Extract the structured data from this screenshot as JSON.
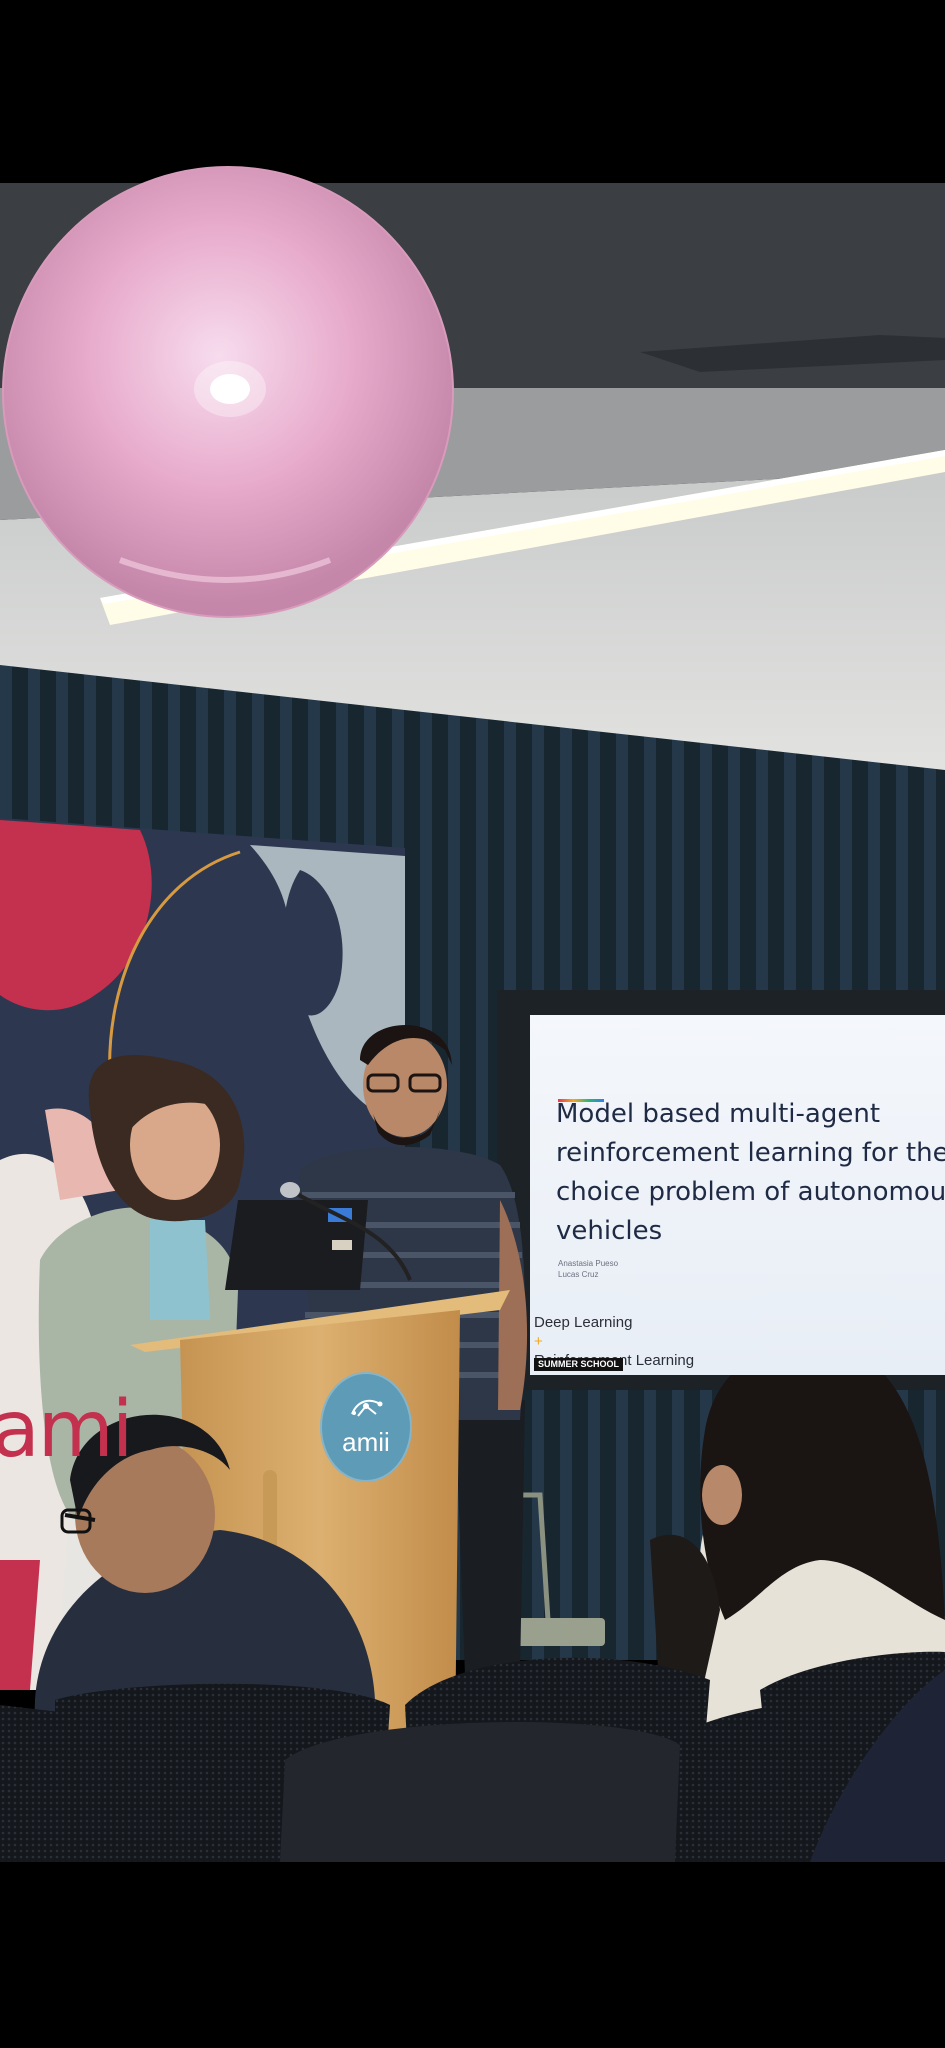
{
  "slide": {
    "title_lines": [
      "Model based multi-agent",
      "reinforcement learning for the r",
      "choice problem of autonomous",
      "vehicles"
    ],
    "authors": [
      "Anastasia Pueso",
      "Lucas Cruz"
    ],
    "course_lines": [
      "Deep Learning",
      "Reinforcement Learning"
    ],
    "plus_sign": "+",
    "badge": "SUMMER SCHOOL"
  },
  "podium": {
    "logo_text": "amii",
    "logo_icon": "network-dots-icon"
  },
  "banner": {
    "partial_text": "ami"
  },
  "colors": {
    "top_bar": "#000000",
    "ceiling": "#3a3d40",
    "wall": "#d9dad9",
    "curtain": "#1a2a34",
    "lamp": "#e8a9c8",
    "banner_pink": "#c3314e",
    "banner_navy": "#2f3a52",
    "podium_wood": "#d4a868",
    "podium_logo": "#5e9bb6",
    "slide_bg": "#eef2f8",
    "slide_text": "#1f2a44"
  }
}
